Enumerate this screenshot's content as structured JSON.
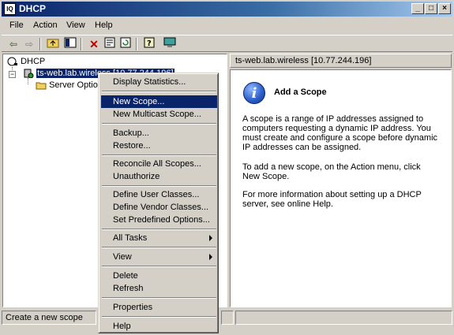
{
  "window": {
    "title": "DHCP"
  },
  "menubar": {
    "file": "File",
    "action": "Action",
    "view": "View",
    "help": "Help"
  },
  "toolbar": {
    "icons": [
      "back-icon",
      "forward-icon",
      "up-folder-icon",
      "show-hide-tree-icon",
      "delete-icon",
      "properties-icon",
      "refresh-icon",
      "help-icon",
      "console-icon"
    ]
  },
  "tree": {
    "root": "DHCP",
    "server": "ts-web.lab.wireless [10.77.244.196]",
    "child": "Server Options"
  },
  "right": {
    "header": "ts-web.lab.wireless [10.77.244.196]",
    "heading": "Add a Scope",
    "p1": "A scope is a range of IP addresses assigned to computers requesting a dynamic IP address. You must create and configure a scope before dynamic IP addresses can be assigned.",
    "p2": "To add a new scope, on the Action menu, click New Scope.",
    "p3": "For more information about setting up a DHCP server, see online Help."
  },
  "context_menu": {
    "display_statistics": "Display Statistics...",
    "new_scope": "New Scope...",
    "new_multicast_scope": "New Multicast Scope...",
    "backup": "Backup...",
    "restore": "Restore...",
    "reconcile_all_scopes": "Reconcile All Scopes...",
    "unauthorize": "Unauthorize",
    "define_user_classes": "Define User Classes...",
    "define_vendor_classes": "Define Vendor Classes...",
    "set_predefined_options": "Set Predefined Options...",
    "all_tasks": "All Tasks",
    "view": "View",
    "delete": "Delete",
    "refresh": "Refresh",
    "properties": "Properties",
    "help": "Help"
  },
  "statusbar": {
    "text": "Create a new scope"
  }
}
